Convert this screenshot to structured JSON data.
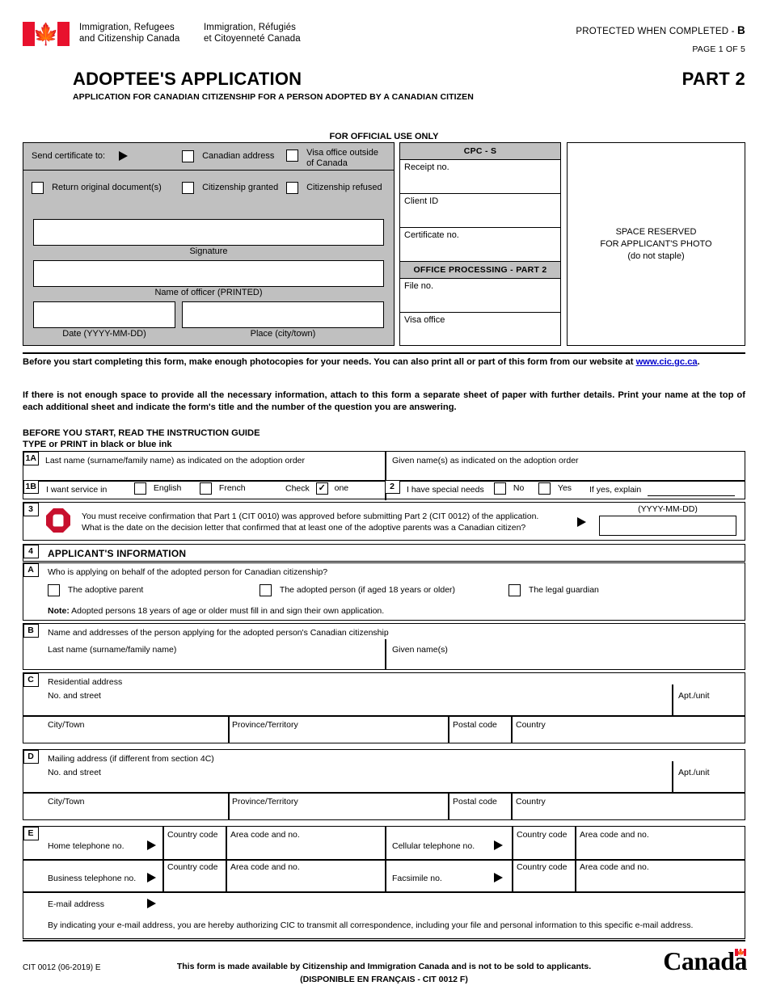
{
  "header": {
    "dept_en": "Immigration, Refugees\nand Citizenship Canada",
    "dept_en_l1": "Immigration, Refugees",
    "dept_en_l2": "and Citizenship Canada",
    "dept_fr_l1": "Immigration, Réfugiés",
    "dept_fr_l2": "et Citoyenneté Canada",
    "protected": "PROTECTED WHEN COMPLETED -",
    "protected_level": "B",
    "page_of": "PAGE 1 OF 5",
    "title": "ADOPTEE'S APPLICATION",
    "part": "PART 2",
    "subtitle": "APPLICATION FOR CANADIAN CITIZENSHIP FOR A PERSON ADOPTED BY A CANADIAN CITIZEN",
    "flag_icon": "canada-flag-icon"
  },
  "official_use": {
    "heading": "FOR OFFICIAL USE ONLY",
    "send_certificate_label": "Send certificate to:",
    "arrow_icon": "right-arrow-icon",
    "checkboxes_row1": [
      {
        "label": "Canadian address",
        "checked": false
      },
      {
        "label": "Visa office outside\nof Canada",
        "label_l1": "Visa office outside",
        "label_l2": "of Canada",
        "checked": false
      }
    ],
    "checkboxes_row2": [
      {
        "label": "Return original document(s)",
        "checked": false
      },
      {
        "label": "Citizenship granted",
        "checked": false
      },
      {
        "label": "Citizenship refused",
        "checked": false
      }
    ],
    "signature_caption": "Signature",
    "officer_caption": "Name of officer (PRINTED)",
    "date_caption": "Date (YYYY-MM-DD)",
    "place_caption": "Place (city/town)",
    "cpc_header": "CPC - S",
    "cpc_fields": [
      "Receipt no.",
      "Client ID",
      "Certificate no."
    ],
    "office_header": "OFFICE PROCESSING - PART 2",
    "office_fields": [
      "File no.",
      "Visa office"
    ],
    "photo_l1": "SPACE RESERVED",
    "photo_l2": "FOR APPLICANT'S PHOTO",
    "photo_l3": "(do not staple)"
  },
  "instructions": {
    "p1_a": "Before you start completing this form, make enough photocopies for your needs. You can also print all or part of this form from our website at",
    "p1_link": "www.cic.gc.ca",
    "p1_b": ".",
    "p2": "If there is not enough space to provide all the necessary information, attach to this form a separate sheet of paper with further details. Print your name at the top of each additional sheet and indicate the form's title and the number of the question you are answering.",
    "p3": "BEFORE YOU START, READ THE INSTRUCTION GUIDE",
    "p4": "TYPE or PRINT in black or blue ink"
  },
  "q1a": {
    "num": "1A",
    "last_name_label": "Last name (surname/family name) as indicated on the adoption order",
    "given_name_label": "Given name(s) as indicated on the adoption order"
  },
  "q1b": {
    "num": "1B",
    "label": "I want service in",
    "option_english": "English",
    "option_french": "French",
    "check_text": "Check",
    "one_text": "one",
    "check_mark": "✓",
    "english_checked": false,
    "french_checked": false
  },
  "q2": {
    "num": "2",
    "label": "I have special needs",
    "option_no": "No",
    "option_yes": "Yes",
    "explain_label": "If yes, explain",
    "no_checked": false,
    "yes_checked": false,
    "explain_value": ""
  },
  "q3": {
    "num": "3",
    "stop_icon": "stop-sign-icon",
    "arrow_icon": "right-arrow-icon",
    "line1": "You must receive confirmation that Part 1 (CIT 0010) was approved before submitting Part 2 (CIT 0012) of the application.",
    "line2": "What is the date on the decision letter that confirmed that at least one of the adoptive parents was a Canadian citizen?",
    "date_format": "(YYYY-MM-DD)",
    "date_value": ""
  },
  "q4": {
    "num": "4",
    "title": "APPLICANT'S INFORMATION",
    "a": {
      "letter": "A",
      "question": "Who is applying on behalf of the adopted person for Canadian citizenship?",
      "options": [
        {
          "label": "The adoptive parent",
          "checked": false
        },
        {
          "label": "The adopted person (if aged 18 years or older)",
          "checked": false
        },
        {
          "label": "The legal guardian",
          "checked": false
        }
      ],
      "note_bold": "Note:",
      "note_rest": " Adopted persons 18 years of age or older must fill in and sign their own application."
    },
    "b": {
      "letter": "B",
      "heading": "Name and addresses of the person applying for the adopted person's Canadian citizenship",
      "last_name_label": "Last name (surname/family name)",
      "given_name_label": "Given name(s)",
      "last_name_value": "",
      "given_name_value": ""
    },
    "c": {
      "letter": "C",
      "heading": "Residential address",
      "street_label": "No. and street",
      "apt_label": "Apt./unit",
      "city_label": "City/Town",
      "province_label": "Province/Territory",
      "postal_label": "Postal code",
      "country_label": "Country"
    },
    "d": {
      "letter": "D",
      "heading": "Mailing address (if different from section 4C)",
      "street_label": "No. and street",
      "apt_label": "Apt./unit",
      "city_label": "City/Town",
      "province_label": "Province/Territory",
      "postal_label": "Postal code",
      "country_label": "Country"
    },
    "e": {
      "letter": "E",
      "home_label": "Home telephone no.",
      "cellular_label": "Cellular telephone no.",
      "business_label": "Business telephone no.",
      "facsimile_label": "Facsimile no.",
      "country_code_label": "Country code",
      "area_code_label": "Area code and no.",
      "email_label": "E-mail address",
      "email_notice": "By indicating your e-mail address, you are hereby authorizing CIC to transmit all correspondence, including your file and personal information to this specific e-mail address.",
      "arrow_icon": "right-arrow-icon"
    }
  },
  "footer": {
    "line1": "This form is made available by Citizenship and Immigration Canada and is not to be sold to applicants.",
    "line2": "(DISPONIBLE EN FRANÇAIS - CIT 0012 F)",
    "code": "CIT 0012 (06-2019) E",
    "wordmark": "Canada",
    "wordmark_flag_icon": "canada-flag-icon"
  },
  "colors": {
    "flag_red": "#e8112d",
    "stop_red": "#c8102e",
    "gray_fill": "#c0c0c0",
    "link": "#0000cc"
  }
}
